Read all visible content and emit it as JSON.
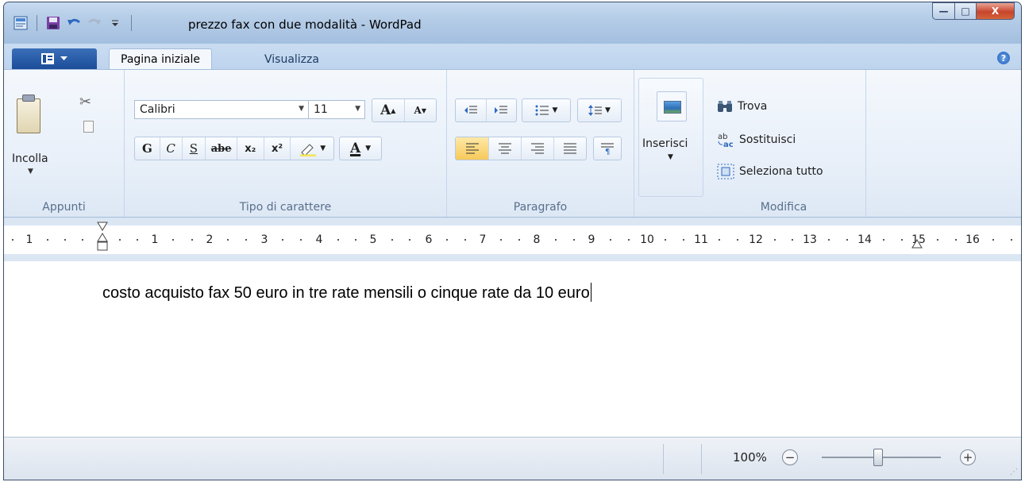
{
  "window": {
    "title": "prezzo fax con due modalità - WordPad",
    "controls": {
      "minimize": "—",
      "maximize": "□",
      "close": "X"
    }
  },
  "quick_access": {
    "icons": [
      "wordpad-icon",
      "save-icon",
      "undo-icon",
      "redo-icon",
      "customize-qat-icon"
    ]
  },
  "ribbon": {
    "tabs": [
      {
        "label": "Pagina iniziale",
        "active": true
      },
      {
        "label": "Visualizza",
        "active": false
      }
    ],
    "help_label": "?",
    "groups": {
      "clipboard": {
        "label": "Appunti",
        "paste_label": "Incolla"
      },
      "font": {
        "label": "Tipo di carattere",
        "font_family": "Calibri",
        "font_size": "11",
        "bold": "G",
        "italic": "C",
        "underline": "S",
        "strikethrough": "abe",
        "subscript": "x₂",
        "superscript": "x²",
        "grow": "A",
        "shrink": "A",
        "font_color": "A"
      },
      "paragraph": {
        "label": "Paragrafo"
      },
      "insert": {
        "label": "Inserisci"
      },
      "edit": {
        "label": "Modifica",
        "find": "Trova",
        "replace": "Sostituisci",
        "select_all": "Seleziona tutto"
      }
    }
  },
  "ruler": {
    "left_labels": [
      "1"
    ],
    "labels": [
      "1",
      "2",
      "3",
      "4",
      "5",
      "6",
      "7",
      "8",
      "9",
      "10",
      "11",
      "12",
      "13",
      "14",
      "15",
      "16"
    ]
  },
  "document": {
    "text": "costo acquisto fax 50 euro in tre rate mensili o cinque rate da 10 euro"
  },
  "statusbar": {
    "zoom": "100%",
    "zoom_out": "−",
    "zoom_in": "+"
  },
  "colors": {
    "titlebar": "#b3cbe6",
    "ribbon": "#e9f0f9",
    "app_button": "#1c4d99",
    "active_align": "#f7c95a",
    "close_button": "#c7452c"
  }
}
